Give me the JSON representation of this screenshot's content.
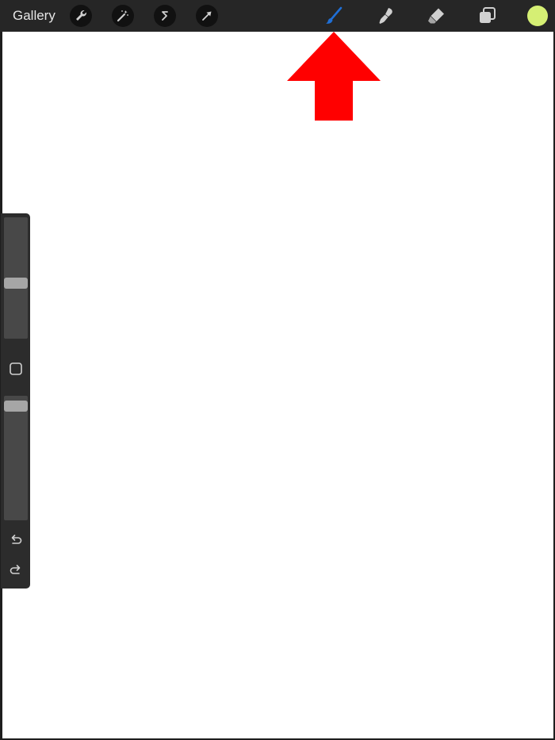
{
  "header": {
    "gallery_label": "Gallery"
  },
  "toolbar": {
    "left_tools": [
      "wrench-icon",
      "magic-wand-icon",
      "selection-icon",
      "transform-arrow-icon"
    ],
    "right_tools": [
      "brush-icon",
      "smudge-icon",
      "eraser-icon",
      "layers-icon"
    ],
    "active_tool": "brush-icon",
    "active_color": "#1f6fd6",
    "icon_color": "#d0d0d0"
  },
  "color": {
    "current": "#d5ef74"
  },
  "annotation": {
    "arrow_color": "#ff0000",
    "points_to": "brush-icon"
  },
  "sidebar": {
    "brush_size": 0.45,
    "opacity": 0.04,
    "buttons": [
      "modify-square-icon",
      "undo-icon",
      "redo-icon"
    ]
  }
}
